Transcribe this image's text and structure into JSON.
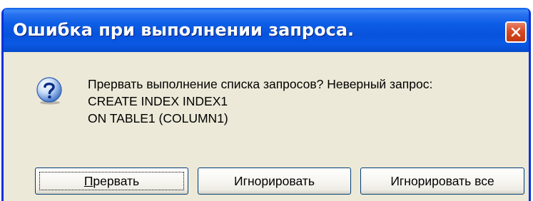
{
  "dialog": {
    "title": "Ошибка при выполнении запроса.",
    "icon": "question-icon",
    "message_lines": [
      "Прервать выполнение списка запросов? Неверный запрос:",
      "CREATE INDEX INDEX1",
      "ON TABLE1 (COLUMN1)"
    ],
    "buttons": {
      "abort_accel": "П",
      "abort_rest": "рервать",
      "ignore": "Игнорировать",
      "ignore_all": "Игнорировать все"
    }
  },
  "colors": {
    "titlebar": "#0a58e4",
    "close": "#d64a24",
    "dialog_bg": "#ece9d8",
    "button_border": "#003c74"
  }
}
